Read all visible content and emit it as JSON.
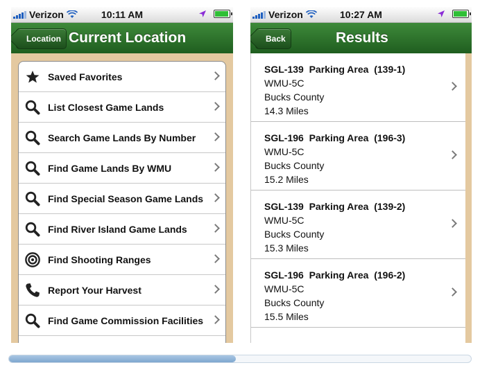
{
  "left": {
    "status": {
      "carrier": "Verizon",
      "time": "10:11 AM"
    },
    "nav": {
      "back_label": "Location",
      "title": "Current Location"
    },
    "menu": [
      {
        "label": "Saved Favorites",
        "icon": "star-icon"
      },
      {
        "label": "List Closest Game Lands",
        "icon": "search-icon"
      },
      {
        "label": "Search Game Lands By Number",
        "icon": "search-icon"
      },
      {
        "label": "Find Game Lands By WMU",
        "icon": "search-icon"
      },
      {
        "label": "Find Special Season Game Lands",
        "icon": "search-icon"
      },
      {
        "label": "Find River Island Game Lands",
        "icon": "search-icon"
      },
      {
        "label": "Find Shooting Ranges",
        "icon": "target-icon"
      },
      {
        "label": "Report Your Harvest",
        "icon": "phone-icon"
      },
      {
        "label": "Find Game Commission Facilities",
        "icon": "search-icon"
      }
    ]
  },
  "right": {
    "status": {
      "carrier": "Verizon",
      "time": "10:27 AM"
    },
    "nav": {
      "back_label": "Back",
      "title": "Results"
    },
    "results": [
      {
        "title": "SGL-139  Parking Area  (139-1)",
        "wmu": "WMU-5C",
        "county": "Bucks County",
        "distance": "14.3 Miles"
      },
      {
        "title": "SGL-196  Parking Area  (196-3)",
        "wmu": "WMU-5C",
        "county": "Bucks County",
        "distance": "15.2 Miles"
      },
      {
        "title": "SGL-139  Parking Area  (139-2)",
        "wmu": "WMU-5C",
        "county": "Bucks County",
        "distance": "15.3 Miles"
      },
      {
        "title": "SGL-196  Parking Area  (196-2)",
        "wmu": "WMU-5C",
        "county": "Bucks County",
        "distance": "15.5 Miles"
      }
    ]
  },
  "scroll": {
    "position_fraction": 0.49
  },
  "colors": {
    "navbar": "#2c722a",
    "background_tan": "#e4c9a0",
    "battery": "#2fbf36",
    "location_arrow": "#8a2bd6"
  }
}
